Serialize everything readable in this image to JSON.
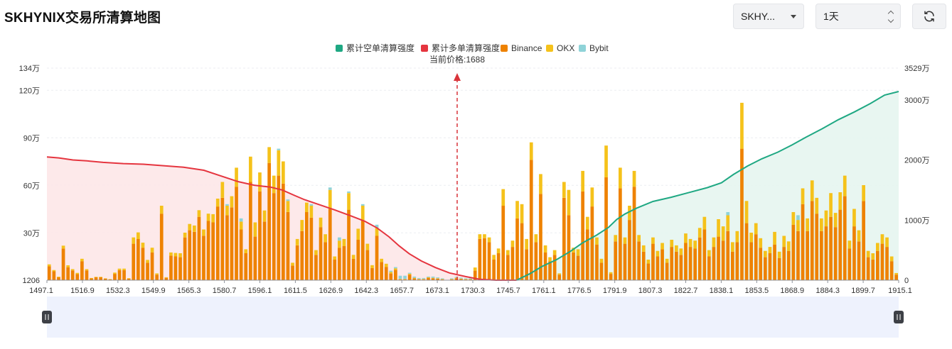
{
  "page": {
    "title": "SKHYNIX交易所清算地图",
    "symbol_select": "SKHY...",
    "period_select": "1天",
    "icons": [
      "chevron-down-icon",
      "stepper-icon",
      "refresh-icon",
      "pause-handle-icon"
    ]
  },
  "colors": {
    "short_line": "#1fa883",
    "short_fill": "#e6f5ef",
    "long_line": "#e5353f",
    "long_fill": "#fde7e8",
    "binance": "#ee8200",
    "okx": "#f5c21b",
    "bybit": "#8fd3d8",
    "price_marker": "#d9343a",
    "slider_bg": "#eef2fd"
  },
  "chart_data": {
    "type": "bar",
    "legend": [
      {
        "name": "累计空单清算强度",
        "color": "#1fa883"
      },
      {
        "name": "累计多单清算强度",
        "color": "#e5353f"
      },
      {
        "name": "Binance",
        "color": "#ee8200"
      },
      {
        "name": "OKX",
        "color": "#f5c21b"
      },
      {
        "name": "Bybit",
        "color": "#8fd3d8"
      }
    ],
    "legend_position": "top-center",
    "current_price_label": "当前价格:1688",
    "current_price": 1688,
    "x_tick_labels": [
      "1497.1",
      "1516.9",
      "1532.3",
      "1549.9",
      "1565.3",
      "1580.7",
      "1596.1",
      "1611.5",
      "1626.9",
      "1642.3",
      "1657.7",
      "1673.1",
      "1730.3",
      "1745.7",
      "1761.1",
      "1776.5",
      "1791.9",
      "1807.3",
      "1822.7",
      "1838.1",
      "1853.5",
      "1868.9",
      "1884.3",
      "1899.7",
      "1915.1"
    ],
    "y_left": {
      "ticks": [
        "1206",
        "30万",
        "60万",
        "90万",
        "120万",
        "134万"
      ],
      "range": [
        1206,
        1340000
      ]
    },
    "y_right": {
      "ticks": [
        "0",
        "1000万",
        "2000万",
        "3000万",
        "3529万"
      ],
      "range": [
        0,
        35290000
      ]
    },
    "grid": true,
    "bars_binance": [
      88000,
      56000,
      18000,
      200000,
      82000,
      62000,
      38000,
      120000,
      62000,
      11000,
      18000,
      18000,
      10000,
      5000,
      40000,
      63000,
      63000,
      10000,
      230000,
      260000,
      205000,
      110000,
      175000,
      35000,
      420000,
      15000,
      155000,
      150000,
      145000,
      270000,
      315000,
      305000,
      400000,
      280000,
      375000,
      365000,
      465000,
      520000,
      410000,
      460000,
      590000,
      320000,
      170000,
      620000,
      275000,
      560000,
      370000,
      740000,
      550000,
      660000,
      610000,
      430000,
      92000,
      220000,
      310000,
      430000,
      395000,
      160000,
      335000,
      240000,
      450000,
      130000,
      205000,
      215000,
      445000,
      135000,
      255000,
      380000,
      190000,
      77000,
      280000,
      115000,
      84000,
      42000,
      65000,
      6000,
      6000,
      35000,
      12000,
      6000,
      6000,
      15000,
      12000,
      10000,
      5000,
      0,
      5000,
      12000,
      8000,
      5000,
      5000,
      60000,
      260000,
      265000,
      240000,
      130000,
      170000,
      470000,
      160000,
      210000,
      390000,
      360000,
      195000,
      760000,
      240000,
      545000,
      175000,
      120000,
      160000,
      35000,
      520000,
      410000,
      175000,
      155000,
      560000,
      320000,
      465000,
      225000,
      110000,
      650000,
      40000,
      245000,
      580000,
      230000,
      380000,
      590000,
      245000,
      180000,
      105000,
      230000,
      150000,
      195000,
      110000,
      210000,
      180000,
      160000,
      235000,
      210000,
      200000,
      270000,
      320000,
      150000,
      210000,
      275000,
      250000,
      310000,
      180000,
      240000,
      830000,
      360000,
      240000,
      290000,
      205000,
      145000,
      170000,
      225000,
      140000,
      210000,
      185000,
      350000,
      310000,
      480000,
      310000,
      500000,
      420000,
      310000,
      340000,
      400000,
      335000,
      445000,
      530000,
      200000,
      340000,
      245000,
      500000,
      145000,
      130000,
      185000,
      230000,
      210000,
      120000,
      35000
    ],
    "bars_okx": [
      12000,
      8000,
      4000,
      18000,
      12000,
      8000,
      8000,
      15000,
      8000,
      3000,
      3000,
      3000,
      2000,
      2000,
      8000,
      10000,
      10000,
      3000,
      40000,
      42000,
      32000,
      18000,
      30000,
      8000,
      50000,
      4000,
      20000,
      22000,
      25000,
      30000,
      40000,
      40000,
      42000,
      40000,
      45000,
      52000,
      50000,
      100000,
      60000,
      70000,
      120000,
      50000,
      25000,
      160000,
      90000,
      120000,
      70000,
      100000,
      110000,
      160000,
      140000,
      70000,
      18000,
      40000,
      70000,
      60000,
      75000,
      30000,
      60000,
      50000,
      120000,
      20000,
      45000,
      45000,
      105000,
      25000,
      70000,
      90000,
      40000,
      18000,
      50000,
      20000,
      20000,
      10000,
      10000,
      2000,
      2000,
      6000,
      3000,
      2000,
      2000,
      3000,
      3000,
      2000,
      2000,
      0,
      2000,
      3000,
      2000,
      2000,
      2000,
      20000,
      30000,
      25000,
      30000,
      30000,
      30000,
      105000,
      30000,
      40000,
      110000,
      120000,
      65000,
      110000,
      50000,
      125000,
      45000,
      25000,
      30000,
      8000,
      100000,
      160000,
      30000,
      40000,
      130000,
      80000,
      120000,
      45000,
      25000,
      200000,
      10000,
      40000,
      130000,
      40000,
      90000,
      100000,
      40000,
      40000,
      25000,
      40000,
      35000,
      40000,
      25000,
      45000,
      40000,
      40000,
      60000,
      50000,
      50000,
      60000,
      80000,
      40000,
      60000,
      110000,
      90000,
      100000,
      60000,
      70000,
      290000,
      140000,
      60000,
      70000,
      60000,
      40000,
      40000,
      80000,
      40000,
      70000,
      60000,
      80000,
      70000,
      100000,
      80000,
      130000,
      100000,
      80000,
      100000,
      150000,
      90000,
      110000,
      130000,
      50000,
      110000,
      70000,
      100000,
      40000,
      40000,
      50000,
      60000,
      60000,
      30000,
      10000
    ],
    "bars_bybit": [
      0,
      0,
      0,
      0,
      0,
      0,
      0,
      0,
      0,
      0,
      0,
      0,
      0,
      0,
      0,
      0,
      0,
      0,
      0,
      0,
      0,
      0,
      0,
      0,
      0,
      0,
      0,
      0,
      0,
      0,
      0,
      0,
      0,
      0,
      0,
      0,
      0,
      0,
      10000,
      0,
      0,
      20000,
      0,
      0,
      0,
      0,
      0,
      0,
      0,
      10000,
      0,
      10000,
      0,
      0,
      0,
      0,
      10000,
      0,
      0,
      0,
      15000,
      0,
      20000,
      0,
      10000,
      0,
      0,
      10000,
      0,
      0,
      20000,
      0,
      0,
      8000,
      8000,
      20000,
      20000,
      6000,
      8000,
      6000,
      6000,
      5000,
      8000,
      6000,
      5000,
      0,
      5000,
      6000,
      6000,
      5000,
      5000,
      0,
      0,
      0,
      0,
      0,
      0,
      0,
      0,
      0,
      0,
      0,
      0,
      0,
      0,
      0,
      0,
      0,
      0,
      0,
      0,
      0,
      0,
      0,
      0,
      0,
      0,
      0,
      0,
      0,
      0,
      0,
      0,
      0,
      0,
      0,
      0,
      0,
      0,
      0,
      0,
      0,
      0,
      0,
      0,
      0,
      0,
      0,
      0,
      0,
      0,
      0,
      0,
      0,
      0,
      20000,
      0,
      0,
      0,
      0,
      0,
      0,
      0,
      0,
      0,
      0,
      0,
      0,
      0,
      0,
      30000,
      0,
      0,
      0,
      0,
      0,
      0,
      0,
      0,
      0,
      0,
      0,
      0,
      0,
      0,
      0,
      0,
      0,
      0,
      0,
      0,
      0,
      0
    ],
    "long_cumulative_wan": [
      [
        1497.1,
        2050
      ],
      [
        1503,
        2035
      ],
      [
        1510,
        2000
      ],
      [
        1517,
        1985
      ],
      [
        1525,
        1960
      ],
      [
        1535,
        1940
      ],
      [
        1545,
        1930
      ],
      [
        1555,
        1905
      ],
      [
        1565,
        1880
      ],
      [
        1575,
        1830
      ],
      [
        1583,
        1740
      ],
      [
        1592,
        1640
      ],
      [
        1600,
        1580
      ],
      [
        1608,
        1550
      ],
      [
        1614,
        1500
      ],
      [
        1620,
        1410
      ],
      [
        1625,
        1340
      ],
      [
        1632,
        1260
      ],
      [
        1640,
        1170
      ],
      [
        1648,
        1070
      ],
      [
        1655,
        980
      ],
      [
        1661,
        870
      ],
      [
        1667,
        720
      ],
      [
        1672,
        570
      ],
      [
        1677,
        440
      ],
      [
        1683,
        320
      ],
      [
        1690,
        210
      ],
      [
        1697,
        120
      ],
      [
        1705,
        60
      ],
      [
        1712,
        15
      ],
      [
        1720,
        0
      ],
      [
        1730.3,
        0
      ]
    ],
    "short_cumulative_wan": [
      [
        1730.3,
        0
      ],
      [
        1737,
        110
      ],
      [
        1743,
        230
      ],
      [
        1750,
        340
      ],
      [
        1757,
        480
      ],
      [
        1763,
        620
      ],
      [
        1770,
        750
      ],
      [
        1776,
        880
      ],
      [
        1780,
        1010
      ],
      [
        1784,
        1100
      ],
      [
        1790,
        1200
      ],
      [
        1798,
        1310
      ],
      [
        1807,
        1380
      ],
      [
        1816,
        1460
      ],
      [
        1825,
        1540
      ],
      [
        1832,
        1620
      ],
      [
        1838,
        1760
      ],
      [
        1845,
        1900
      ],
      [
        1852,
        2020
      ],
      [
        1860,
        2130
      ],
      [
        1867,
        2250
      ],
      [
        1874,
        2380
      ],
      [
        1882,
        2520
      ],
      [
        1890,
        2670
      ],
      [
        1898,
        2800
      ],
      [
        1906,
        2940
      ],
      [
        1913,
        3080
      ],
      [
        1920,
        3140
      ]
    ],
    "slider": {
      "start": 0,
      "end": 100
    }
  }
}
